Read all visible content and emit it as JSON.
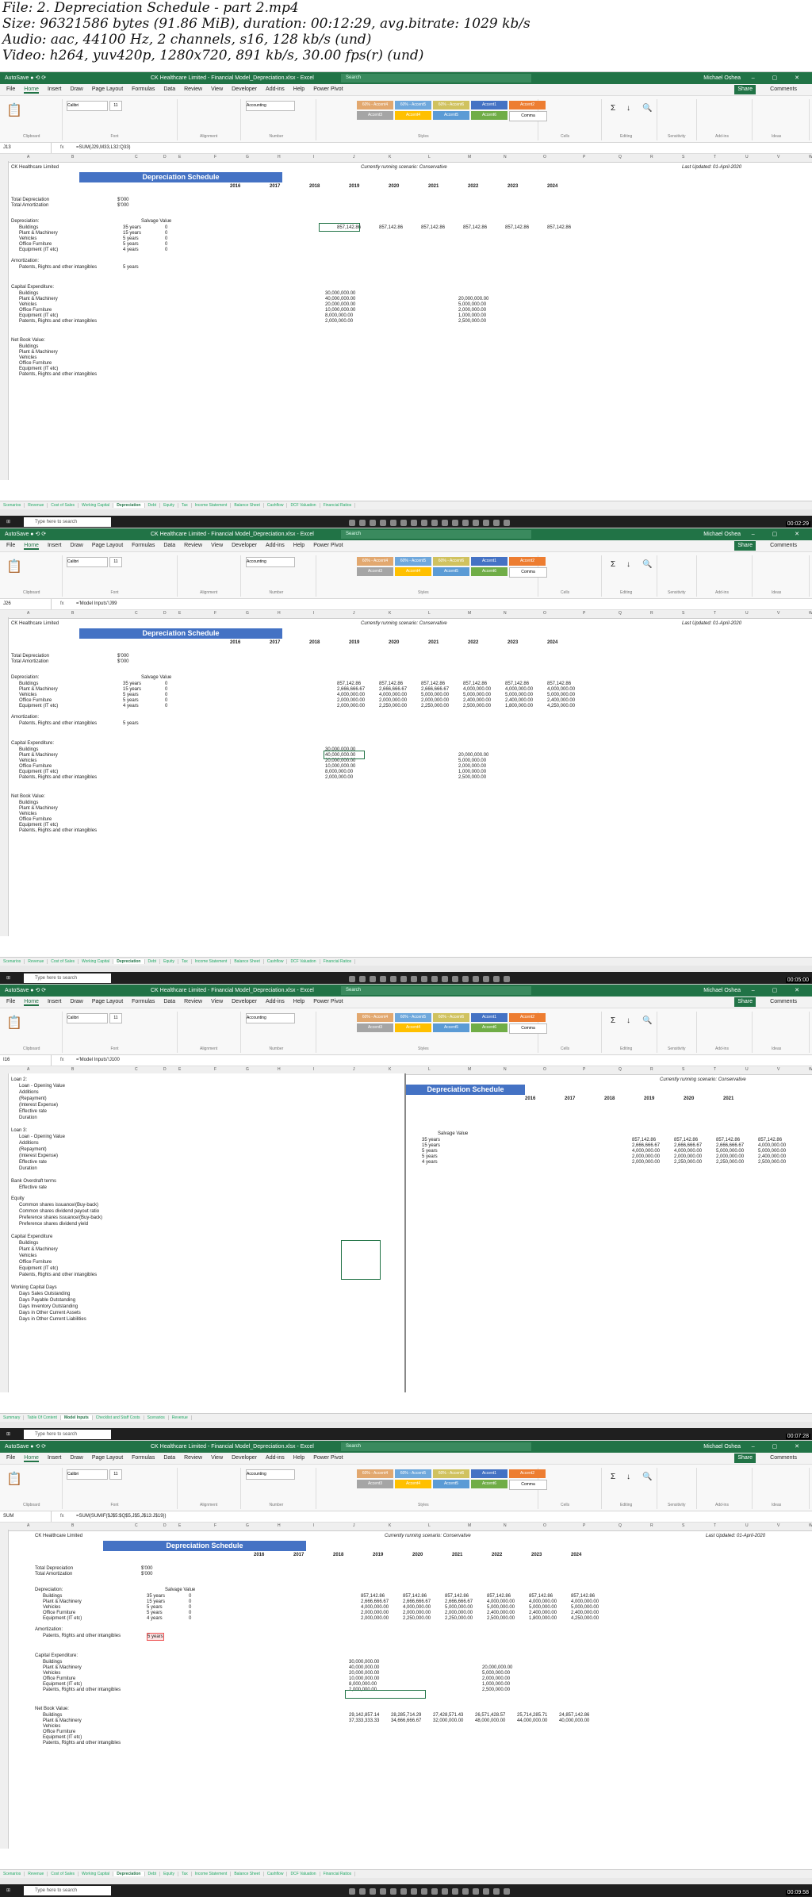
{
  "meta": {
    "file": "File: 2. Depreciation Schedule - part 2.mp4",
    "size": "Size: 96321586 bytes (91.86 MiB), duration: 00:12:29, avg.bitrate: 1029 kb/s",
    "audio": "Audio: aac, 44100 Hz, 2 channels, s16, 128 kb/s (und)",
    "video": "Video: h264, yuv420p, 1280x720, 891 kb/s, 30.00 fps(r) (und)"
  },
  "app": {
    "title": "CK Healthcare Limited - Financial Model_Depreciation.xlsx - Excel",
    "search": "Search",
    "user": "Michael Oshea",
    "tabs": [
      "File",
      "Home",
      "Insert",
      "Draw",
      "Page Layout",
      "Formulas",
      "Data",
      "Review",
      "View",
      "Developer",
      "Add-ins",
      "Help",
      "Power Pivot"
    ],
    "share": "Share",
    "comments": "Comments",
    "font": "Calibri",
    "fontsize": "11",
    "numfmt": "Accounting",
    "styles": [
      "60% - Accent4",
      "60% - Accent5",
      "60% - Accent6",
      "Accent1",
      "Accent2",
      "Accent3",
      "Accent4",
      "Accent5",
      "Accent6",
      "Comma"
    ],
    "groups": [
      "Clipboard",
      "Font",
      "Alignment",
      "Number",
      "Styles",
      "Cells",
      "Editing",
      "Sensitivity",
      "Add-ins",
      "Ideas"
    ]
  },
  "frames": [
    {
      "formula": "=SUM(J29,M33,L32:Q33)",
      "namebox": "J13",
      "time": "00:02:29"
    },
    {
      "formula": "='Model Inputs'!J99",
      "namebox": "J26",
      "time": "00:05:00"
    },
    {
      "formula": "='Model Inputs'!J100",
      "namebox": "I16",
      "time": "00:07:28"
    },
    {
      "formula": "=SUM(SUMIF($J$5:$Q$5,J$5,J$13:J$19))",
      "namebox": "SUM",
      "time": "00:09:58"
    }
  ],
  "sheet": {
    "company": "CK Healthcare Limited",
    "scenario": "Currently running scenario: Conservative",
    "updated": "Last Updated: 01-April-2020",
    "heading": "Depreciation Schedule",
    "years": [
      "2016",
      "2017",
      "2018",
      "2019",
      "2020",
      "2021",
      "2022",
      "2023",
      "2024"
    ],
    "total_dep": "Total Depreciation",
    "total_amort": "Total Amortization",
    "unit": "$'000",
    "depreciation": "Depreciation:",
    "salvage": "Salvage Value",
    "assets": [
      "Buildings",
      "Plant & Machinery",
      "Vehicles",
      "Office Furniture",
      "Equipment (IT etc)"
    ],
    "asset_life": [
      "35 years",
      "15 years",
      "5 years",
      "5 years",
      "4 years"
    ],
    "amortization": "Amortization:",
    "intangibles": "Patents, Rights and other intangibles",
    "intang_life": "5 years",
    "capex": "Capital Expenditure:",
    "nbv": "Net Book Value:",
    "dep_row1": [
      "857,142.86",
      "857,142.86",
      "857,142.86",
      "857,142.86",
      "857,142.86",
      "857,142.86"
    ],
    "dep_row2": [
      "2,666,666.67",
      "2,666,666.67",
      "2,666,666.67",
      "4,000,000.00",
      "4,000,000.00",
      "4,000,000.00"
    ],
    "dep_row3": [
      "4,000,000.00",
      "4,000,000.00",
      "5,000,000.00",
      "5,000,000.00",
      "5,000,000.00",
      "5,000,000.00"
    ],
    "dep_row4": [
      "2,000,000.00",
      "2,000,000.00",
      "2,000,000.00",
      "2,400,000.00",
      "2,400,000.00",
      "2,400,000.00"
    ],
    "dep_row5": [
      "2,000,000.00",
      "2,250,000.00",
      "2,250,000.00",
      "2,500,000.00",
      "1,800,000.00",
      "4,250,000.00"
    ],
    "capex_vals": [
      "30,000,000.00",
      "40,000,000.00",
      "20,000,000.00",
      "10,000,000.00",
      "8,000,000.00",
      "2,000,000.00"
    ],
    "capex_2022": [
      "20,000,000.00",
      "5,000,000.00",
      "2,000,000.00",
      "1,000,000.00",
      "2,500,000.00"
    ],
    "nbv_row1": [
      "29,142,857.14",
      "28,285,714.29",
      "27,428,571.43",
      "26,571,428.57",
      "25,714,285.71",
      "24,857,142.86"
    ],
    "nbv_row2": [
      "37,333,333.33",
      "34,666,666.67",
      "32,000,000.00",
      "48,000,000.00",
      "44,000,000.00",
      "40,000,000.00"
    ],
    "sheet_tabs": [
      "Scenarios",
      "Revenue",
      "Cost of Sales",
      "Working Capital",
      "Depreciation",
      "Debt",
      "Equity",
      "Tax",
      "Income Statement",
      "Balance Sheet",
      "Cashflow",
      "DCF Valuation",
      "Financial Ratios"
    ],
    "taskbar_search": "Type here to search"
  },
  "inputs": {
    "loan2": "Loan 2:",
    "loan3": "Loan 3:",
    "loan_rows": [
      "Loan - Opening Value",
      "Additions",
      "(Repayment)",
      "(Interest Expense)",
      "Effective rate",
      "Duration"
    ],
    "overdraft": "Bank Overdraft terms",
    "eff_rate": "Effective rate",
    "equity": "Equity",
    "equity_rows": [
      "Common shares issuance/(Buy-back)",
      "Common shares dividend payout ratio",
      "Preference shares issuance/(Buy-back)",
      "Preference shares dividend yield"
    ],
    "capex_title": "Capital Expenditure",
    "wc": "Working Capital Days",
    "wc_rows": [
      "Days Sales Outstanding",
      "Days Payable Outstanding",
      "Days Inventory Outstanding",
      "Days in Other Current Assets",
      "Days in Other Current Liabilities"
    ],
    "tabs": [
      "Summary",
      "Table Of Content",
      "Model Inputs",
      "Checklist and Staff Costs",
      "Scenarios",
      "Revenue"
    ]
  }
}
